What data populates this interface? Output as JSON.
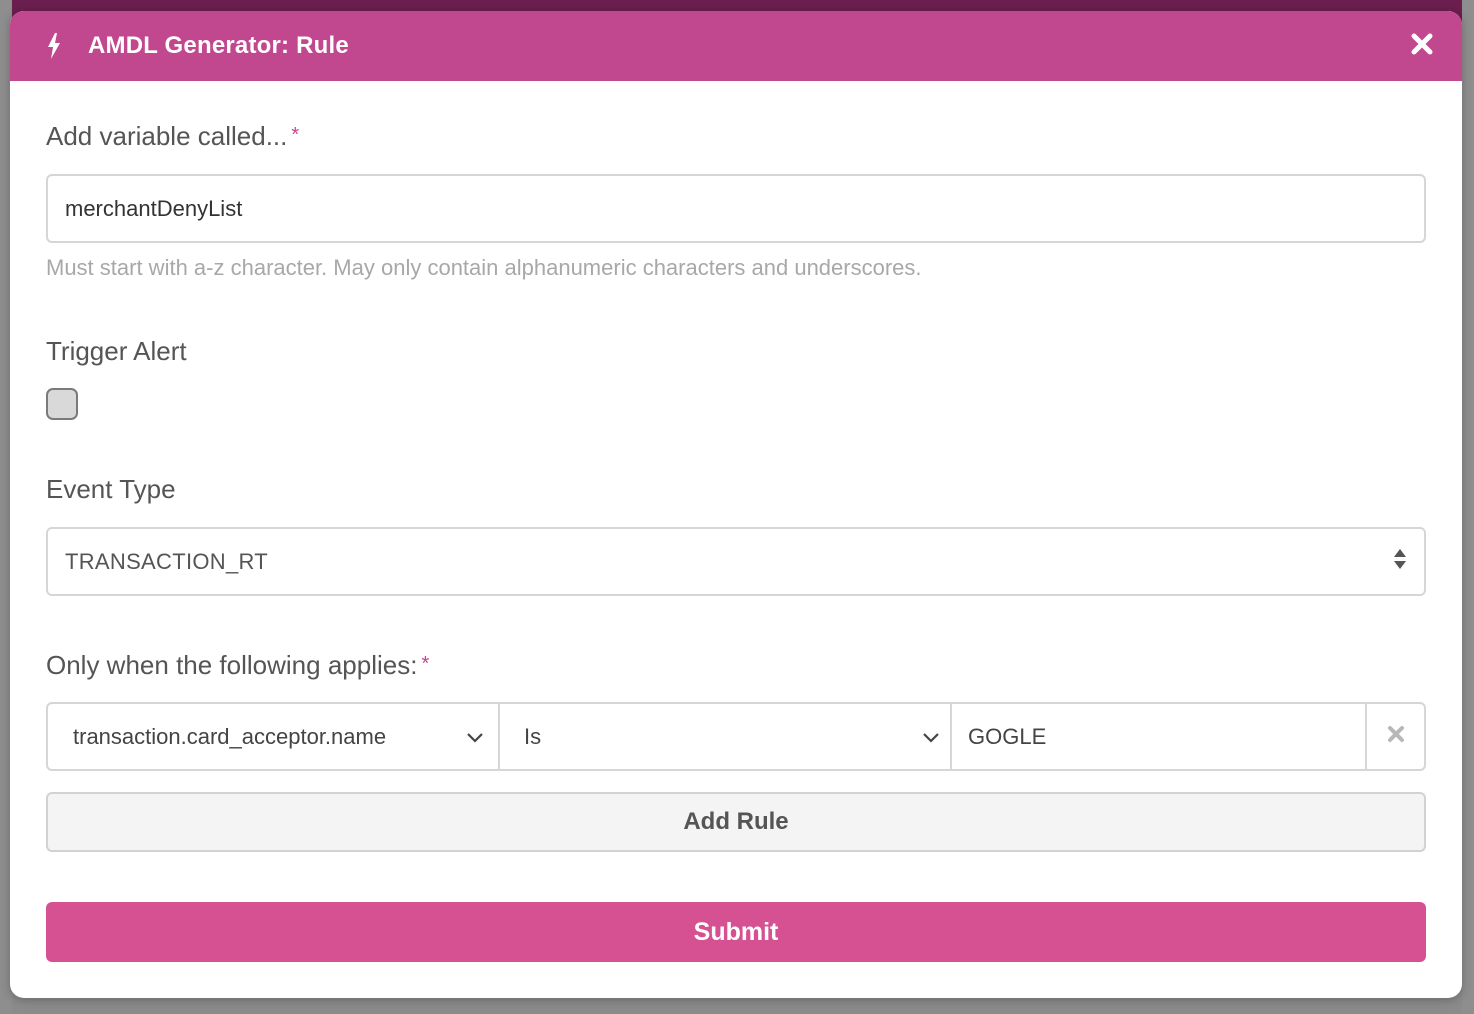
{
  "modal": {
    "title": "AMDL Generator: Rule",
    "header_icon": "bolt-icon",
    "close_icon": "close-icon"
  },
  "colors": {
    "accent": "#c1478f",
    "submit": "#d65192",
    "hint_text": "#a8a8a8",
    "border": "#d6d6d6"
  },
  "variable": {
    "label": "Add variable called...",
    "required_mark": "*",
    "value": "merchantDenyList",
    "hint": "Must start with a-z character. May only contain alphanumeric characters and underscores."
  },
  "trigger_alert": {
    "label": "Trigger Alert",
    "checked": false
  },
  "event_type": {
    "label": "Event Type",
    "selected": "TRANSACTION_RT"
  },
  "conditions": {
    "label": "Only when the following applies:",
    "required_mark": "*",
    "rules": [
      {
        "field": "transaction.card_acceptor.name",
        "operator": "Is",
        "value": "GOGLE"
      }
    ],
    "add_rule_label": "Add Rule"
  },
  "submit_label": "Submit"
}
